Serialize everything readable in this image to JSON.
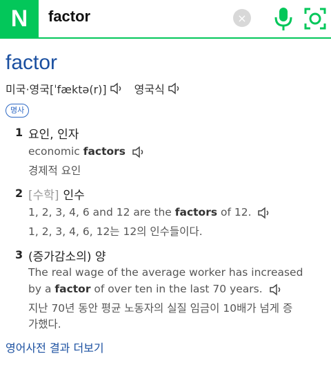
{
  "search": {
    "logo": "N",
    "query": "factor",
    "clear_icon": "×"
  },
  "entry": {
    "word": "factor",
    "pron_us_uk": "미국·영국[ˈfæktə(r)]",
    "pron_uk": "영국식",
    "pos": "명사"
  },
  "senses": [
    {
      "num": "1",
      "tag": "",
      "def": "요인, 인자",
      "ex_en_parts": [
        "economic ",
        "factors",
        ""
      ],
      "ex_ko": "경제적 요인"
    },
    {
      "num": "2",
      "tag": "[수학]",
      "def": "인수",
      "ex_en_parts": [
        "1, 2, 3, 4, 6 and 12 are the ",
        "factors",
        " of 12."
      ],
      "ex_ko": "1, 2, 3, 4, 6, 12는 12의 인수들이다."
    },
    {
      "num": "3",
      "tag": "",
      "def": "(증가감소의) 양",
      "ex_en_line1": "The real wage of the average worker has increased",
      "ex_en_parts": [
        "by a ",
        "factor",
        " of over ten in the last 70 years."
      ],
      "ex_ko_line1": "지난 70년 동안 평균 노동자의 실질 임금이 10배가 넘게 증",
      "ex_ko_line2": "가했다."
    }
  ],
  "more_link": "영어사전 결과 더보기",
  "colors": {
    "brand_green": "#03c75a",
    "link_blue": "#1a4fa0"
  },
  "icons": [
    "clear-icon",
    "mic-icon",
    "lens-icon",
    "speaker-icon"
  ]
}
